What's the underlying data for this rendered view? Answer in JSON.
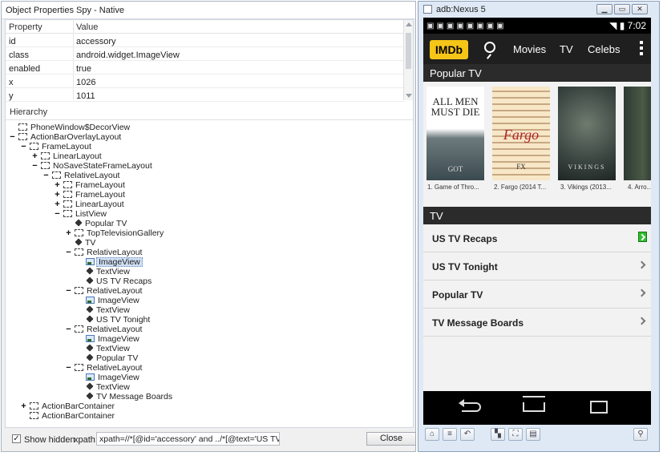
{
  "spy": {
    "title": "Object Properties Spy - Native",
    "props_header": {
      "property": "Property",
      "value": "Value"
    },
    "properties": [
      {
        "name": "id",
        "value": "accessory"
      },
      {
        "name": "class",
        "value": "android.widget.ImageView"
      },
      {
        "name": "enabled",
        "value": "true"
      },
      {
        "name": "x",
        "value": "1026"
      },
      {
        "name": "y",
        "value": "1011"
      }
    ],
    "hierarchy_label": "Hierarchy",
    "tree": [
      {
        "label": "PhoneWindow$DecorView",
        "toggle": "",
        "icon": "box"
      },
      {
        "label": "ActionBarOverlayLayout",
        "toggle": "−",
        "icon": "box"
      },
      {
        "label": "FrameLayout",
        "toggle": "−",
        "icon": "box"
      },
      {
        "label": "LinearLayout",
        "toggle": "+",
        "icon": "box"
      },
      {
        "label": "NoSaveStateFrameLayout",
        "toggle": "−",
        "icon": "box"
      },
      {
        "label": "RelativeLayout",
        "toggle": "−",
        "icon": "box"
      },
      {
        "label": "FrameLayout",
        "toggle": "+",
        "icon": "box"
      },
      {
        "label": "FrameLayout",
        "toggle": "+",
        "icon": "box"
      },
      {
        "label": "LinearLayout",
        "toggle": "+",
        "icon": "box"
      },
      {
        "label": "ListView",
        "toggle": "−",
        "icon": "box"
      },
      {
        "label": "Popular TV",
        "toggle": "",
        "icon": "tag"
      },
      {
        "label": "TopTelevisionGallery",
        "toggle": "+",
        "icon": "box"
      },
      {
        "label": "TV",
        "toggle": "",
        "icon": "tag"
      },
      {
        "label": "RelativeLayout",
        "toggle": "−",
        "icon": "box"
      },
      {
        "label": "ImageView",
        "toggle": "",
        "icon": "img",
        "selected": true
      },
      {
        "label": "TextView",
        "toggle": "",
        "icon": "tag"
      },
      {
        "label": "US TV Recaps",
        "toggle": "",
        "icon": "tag"
      },
      {
        "label": "RelativeLayout",
        "toggle": "−",
        "icon": "box"
      },
      {
        "label": "ImageView",
        "toggle": "",
        "icon": "img"
      },
      {
        "label": "TextView",
        "toggle": "",
        "icon": "tag"
      },
      {
        "label": "US TV Tonight",
        "toggle": "",
        "icon": "tag"
      },
      {
        "label": "RelativeLayout",
        "toggle": "−",
        "icon": "box"
      },
      {
        "label": "ImageView",
        "toggle": "",
        "icon": "img"
      },
      {
        "label": "TextView",
        "toggle": "",
        "icon": "tag"
      },
      {
        "label": "Popular TV",
        "toggle": "",
        "icon": "tag"
      },
      {
        "label": "RelativeLayout",
        "toggle": "−",
        "icon": "box"
      },
      {
        "label": "ImageView",
        "toggle": "",
        "icon": "img"
      },
      {
        "label": "TextView",
        "toggle": "",
        "icon": "tag"
      },
      {
        "label": "TV Message Boards",
        "toggle": "",
        "icon": "tag"
      },
      {
        "label": "ActionBarContainer",
        "toggle": "+",
        "icon": "box"
      },
      {
        "label": "ActionBarContainer",
        "toggle": "",
        "icon": "box"
      }
    ],
    "show_hidden": {
      "label": "Show hidden",
      "checked": true
    },
    "xpath_label": "xpath:",
    "xpath_value": "xpath=//*[@id='accessory' and ../*[@text='US TV Recaps']]",
    "close_label": "Close"
  },
  "emulator": {
    "title": "adb:Nexus 5",
    "status_time": "7:02",
    "app": {
      "logo": "IMDb",
      "nav": [
        "Movies",
        "TV",
        "Celebs"
      ]
    },
    "popular_header": "Popular TV",
    "gallery": [
      {
        "caption": "1. Game of Thro...",
        "poster_text": "ALL MEN MUST DIE",
        "poster_sub": "GOT"
      },
      {
        "caption": "2. Fargo (2014 T...",
        "poster_text": "Fargo",
        "poster_sub": "FX"
      },
      {
        "caption": "3. Vikings (2013...",
        "poster_text": "VIKINGS",
        "poster_sub": ""
      },
      {
        "caption": "4. Arro...",
        "poster_text": "",
        "poster_sub": ""
      }
    ],
    "tv_header": "TV",
    "list": [
      "US TV Recaps",
      "US TV Tonight",
      "Popular TV",
      "TV Message Boards"
    ]
  },
  "icons": {
    "window_controls": [
      "minimize-icon",
      "restore-icon",
      "close-icon"
    ],
    "toolbar": [
      "home-icon",
      "menu-icon",
      "back-icon",
      "rotate-icon",
      "screenshot-icon",
      "inspect-icon",
      "key-icon"
    ]
  },
  "colors": {
    "imdb_yellow": "#f5c518",
    "highlight_green": "#2fbf2f",
    "selection_blue": "#cfe0f5"
  }
}
